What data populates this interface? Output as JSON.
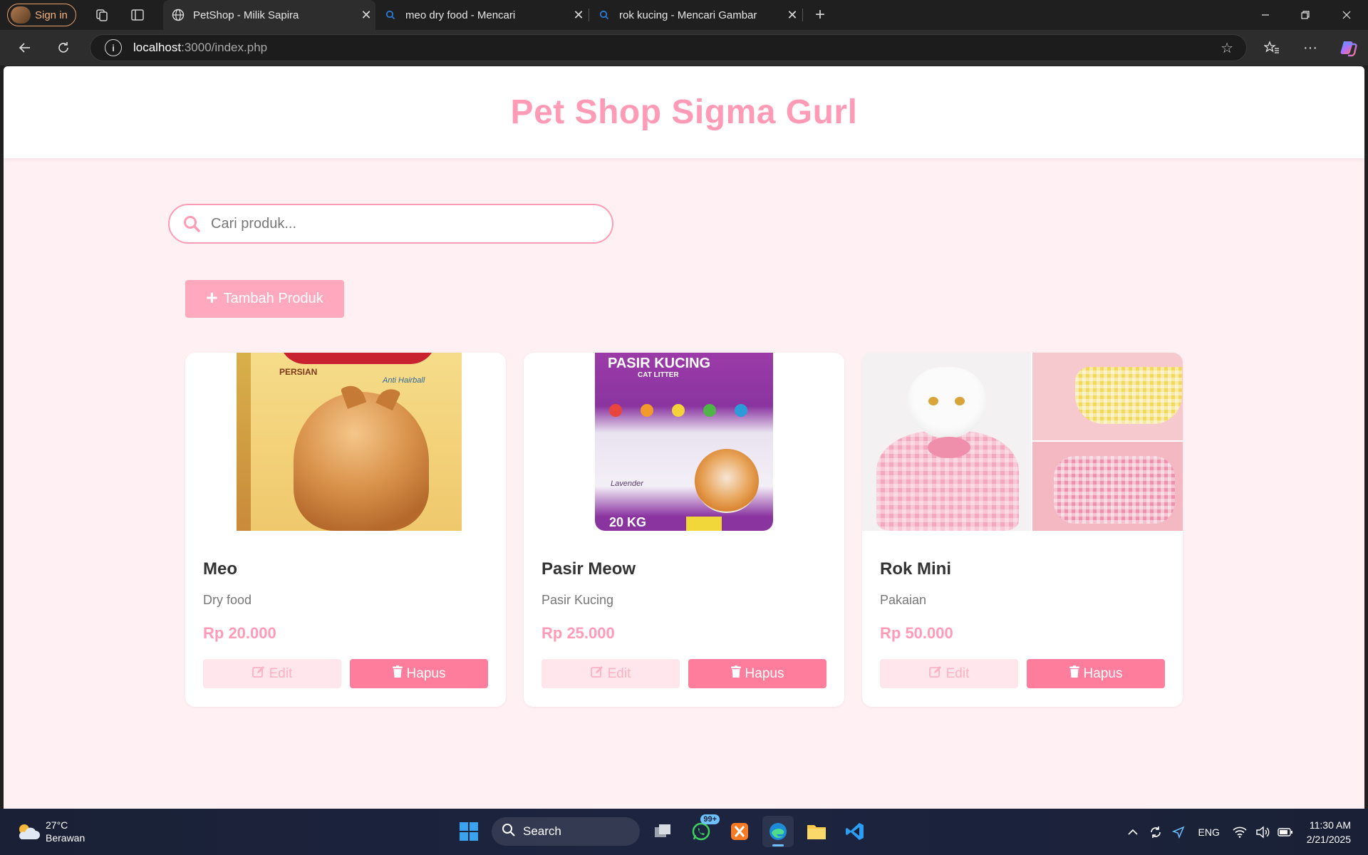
{
  "browser": {
    "signin_label": "Sign in",
    "tabs": [
      {
        "title": "PetShop - Milik Sapira",
        "active": true,
        "icon": "globe-icon"
      },
      {
        "title": "meo dry food - Mencari",
        "active": false,
        "icon": "bing-search-icon"
      },
      {
        "title": "rok kucing - Mencari Gambar",
        "active": false,
        "icon": "bing-search-icon"
      }
    ],
    "url_host": "localhost",
    "url_rest": ":3000/index.php"
  },
  "page": {
    "site_title": "Pet Shop Sigma Gurl",
    "search_placeholder": "Cari produk...",
    "add_button_label": "Tambah Produk",
    "edit_label": "Edit",
    "delete_label": "Hapus",
    "products": [
      {
        "name": "Meo",
        "category": "Dry food",
        "price": "Rp 20.000"
      },
      {
        "name": "Pasir Meow",
        "category": "Pasir Kucing",
        "price": "Rp 25.000"
      },
      {
        "name": "Rok Mini",
        "category": "Pakaian",
        "price": "Rp 50.000"
      }
    ],
    "product_images": {
      "meo_brand": "PERSIAN",
      "meo_tagline": "Anti Hairball",
      "pasir_title": "PASIR KUCING",
      "pasir_subtitle": "CAT LITTER",
      "pasir_scent": "Lavender",
      "pasir_weight": "20 KG"
    },
    "colors": {
      "accent": "#ff9bb6",
      "background": "#fff0f3",
      "delete": "#ff7d9c",
      "edit_bg": "#ffe6ec"
    }
  },
  "taskbar": {
    "weather_temp": "27°C",
    "weather_desc": "Berawan",
    "search_label": "Search",
    "whatsapp_badge": "99+",
    "language": "ENG",
    "time": "11:30 AM",
    "date": "2/21/2025"
  }
}
